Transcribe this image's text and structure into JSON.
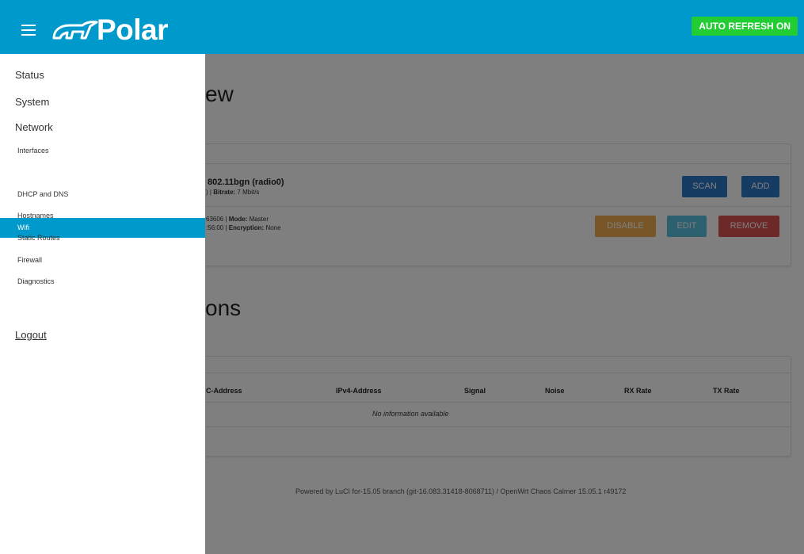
{
  "header": {
    "brand": "Polar",
    "auto_refresh": "AUTO REFRESH ON"
  },
  "sidebar": {
    "items": [
      {
        "label": "Status"
      },
      {
        "label": "System"
      },
      {
        "label": "Network"
      }
    ],
    "network_sub": [
      {
        "label": "Interfaces"
      },
      {
        "label": "Wifi"
      },
      {
        "label": "DHCP and DNS"
      },
      {
        "label": "Hostnames"
      },
      {
        "label": "Static Routes"
      },
      {
        "label": "Firewall"
      },
      {
        "label": "Diagnostics"
      }
    ],
    "active_sub_index": 1,
    "logout": "Logout"
  },
  "main": {
    "overview_heading": "ew",
    "radio": {
      "title": "802.11bgn (radio0)",
      "subtitle_prefix": ") | ",
      "bitrate_label": "Bitrate:",
      "bitrate_value": " 7 Mbit/s",
      "scan": "SCAN",
      "add": "ADD"
    },
    "network": {
      "line1_prefix": "63606 | ",
      "mode_label": "Mode:",
      "mode_value": " Master",
      "line2_prefix": ":56:00 | ",
      "enc_label": "Encryption:",
      "enc_value": " None",
      "disable": "DISABLE",
      "edit": "EDIT",
      "remove": "REMOVE"
    },
    "stations_heading": "ons",
    "table": {
      "headers": [
        "C-Address",
        "IPv4-Address",
        "Signal",
        "Noise",
        "RX Rate",
        "TX Rate"
      ],
      "empty": "No information available"
    },
    "footer": "Powered by LuCI for-15.05 branch (git-16.083.31418-8068711) / OpenWrt Chaos Calmer 15.05.1 r49172"
  },
  "colors": {
    "header_bg": "#0099cc",
    "auto_refresh_bg": "#22cc33",
    "active_nav_bg": "#0099cc"
  }
}
